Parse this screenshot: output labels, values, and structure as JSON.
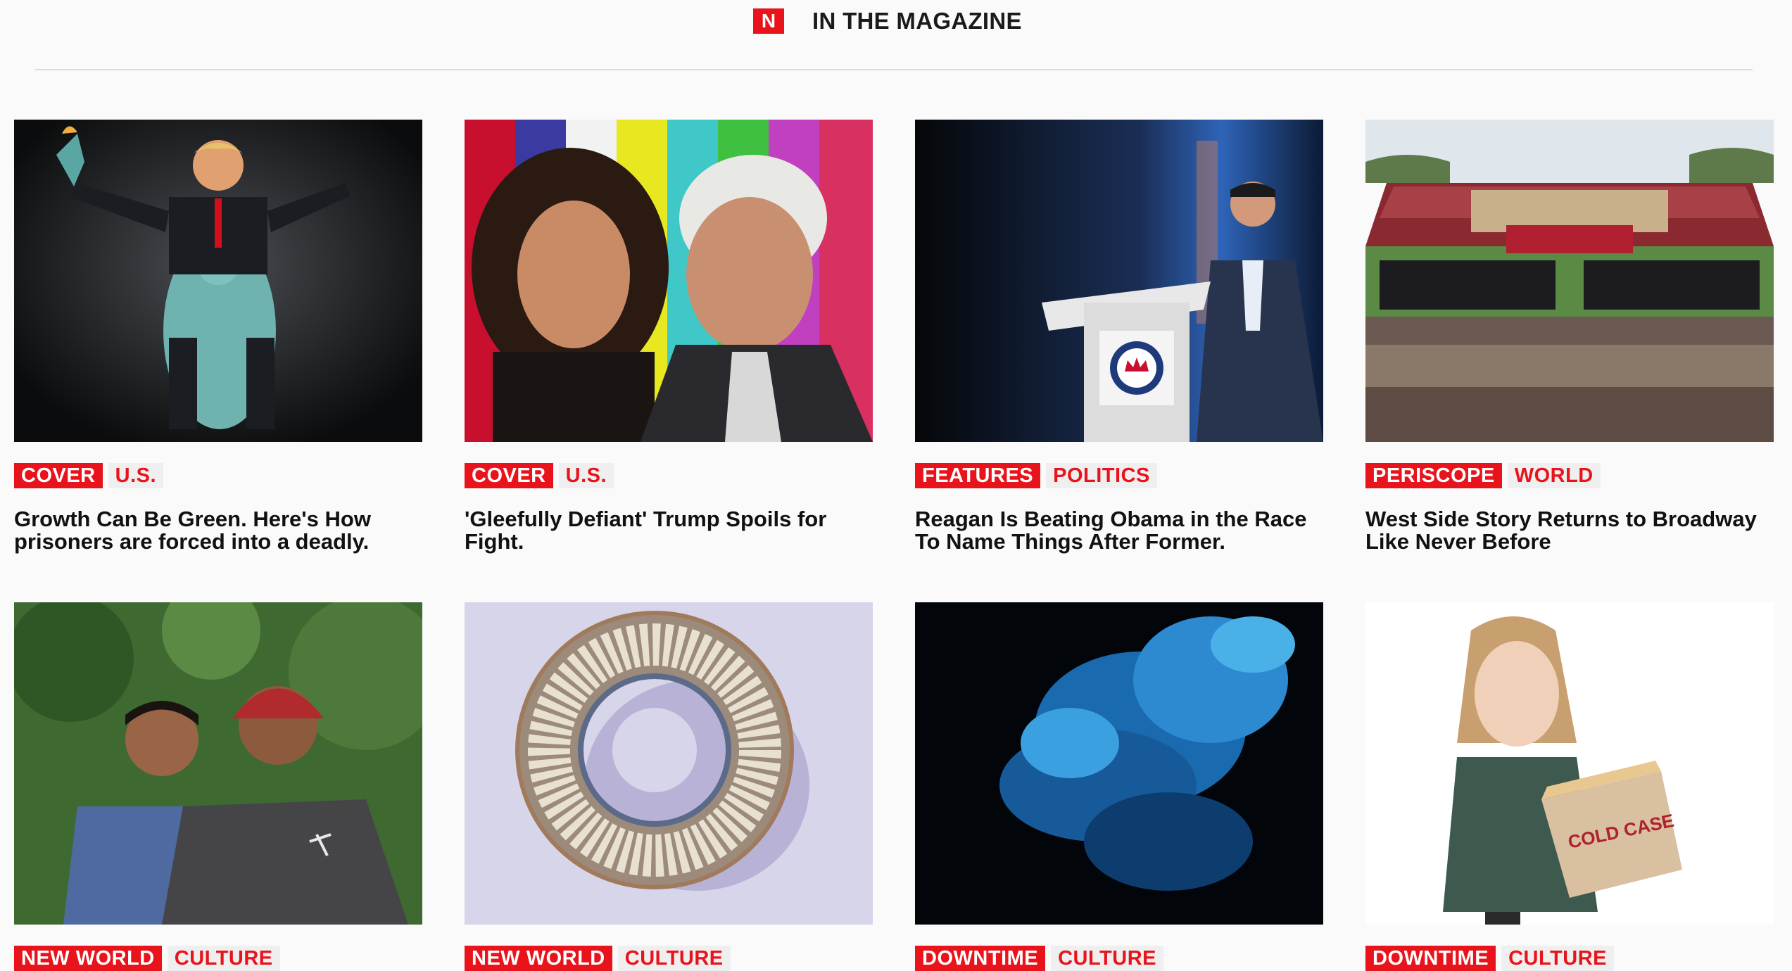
{
  "header": {
    "logo_letter": "N",
    "section_title": "IN THE MAGAZINE"
  },
  "colors": {
    "accent": "#e8131b",
    "tag_secondary_bg": "#efefef",
    "page_bg": "#fafafa"
  },
  "cards": [
    {
      "tag": "COVER",
      "category": "U.S.",
      "headline": "Growth Can Be Green. Here's How prisoners are forced into a deadly.",
      "image": "trump-statue-of-liberty-illustration"
    },
    {
      "tag": "COVER",
      "category": "U.S.",
      "headline": "'Gleefully Defiant' Trump Spoils for Fight.",
      "image": "woman-and-older-man-color-bars"
    },
    {
      "tag": "FEATURES",
      "category": "POLITICS",
      "headline": "Reagan Is Beating Obama in the Race To Name Things After Former.",
      "image": "speaker-at-podium"
    },
    {
      "tag": "PERISCOPE",
      "category": "WORLD",
      "headline": "West Side Story Returns to Broadway Like Never Before",
      "image": "stadium-graduation-ceremony"
    },
    {
      "tag": "NEW WORLD",
      "category": "CULTURE",
      "headline": "",
      "image": "two-men-outdoors"
    },
    {
      "tag": "NEW WORLD",
      "category": "CULTURE",
      "headline": "",
      "image": "ring-of-books"
    },
    {
      "tag": "DOWNTIME",
      "category": "CULTURE",
      "headline": "",
      "image": "blue-ink-smoke"
    },
    {
      "tag": "DOWNTIME",
      "category": "CULTURE",
      "headline": "",
      "image": "woman-carrying-cold-case-box"
    }
  ],
  "image_labels": {
    "cold_case": "COLD CASE"
  }
}
